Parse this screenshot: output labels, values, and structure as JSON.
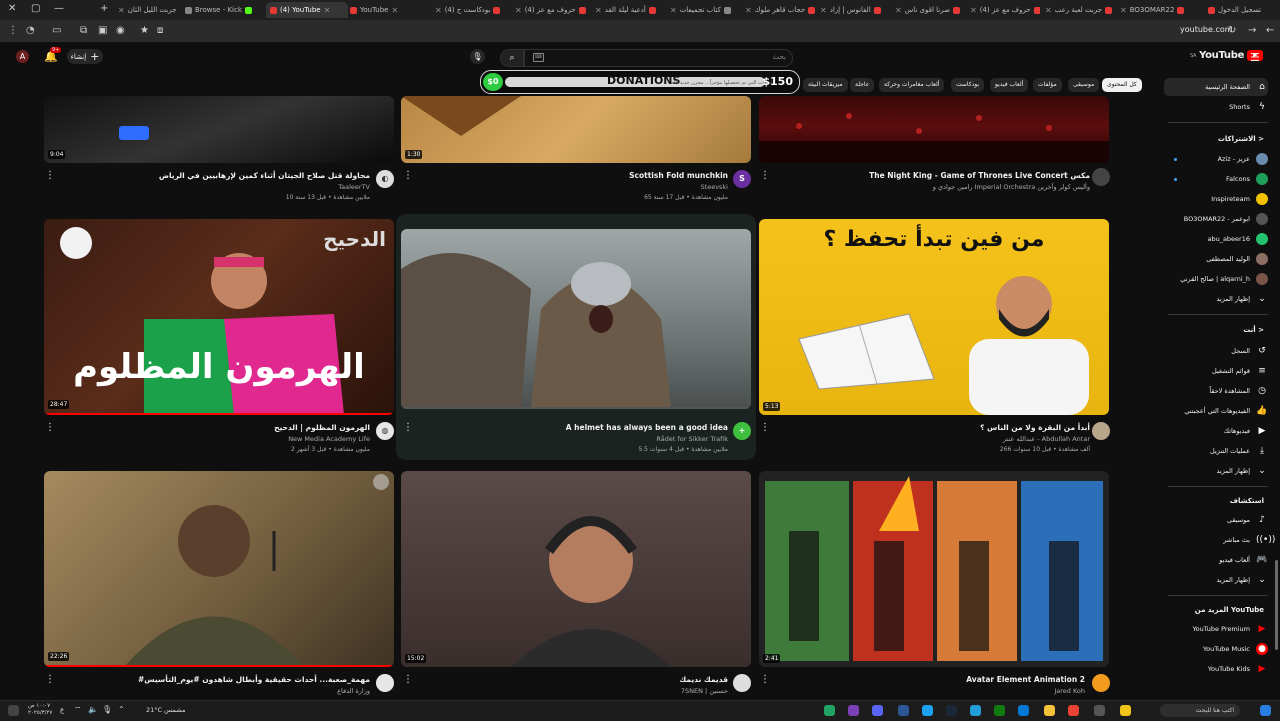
{
  "browser": {
    "tabs": [
      {
        "label": "تسجيل الدخول"
      },
      {
        "label": "BO3OMAR22"
      },
      {
        "label": "جربت لعبة رعب"
      },
      {
        "label": "(4) حروف مع عز"
      },
      {
        "label": "صرنا اقوى ناس"
      },
      {
        "label": "الفانوس | إراد"
      },
      {
        "label": "حجاب قاهر ملوك"
      },
      {
        "label": "كتاب تجميعات"
      },
      {
        "label": "أدعية ليلة القد"
      },
      {
        "label": "(4) حروف مع عز"
      },
      {
        "label": "(4) بودكاست ح"
      },
      {
        "label": "YouTube"
      },
      {
        "label": "(4) YouTube"
      },
      {
        "label": "Browse - Kick"
      },
      {
        "label": "جربت الليل الثان"
      }
    ],
    "address": "youtube.com"
  },
  "header": {
    "avatar_letter": "A",
    "notif_count": "9+",
    "create_label": "إنشاء",
    "search_placeholder": "بحث",
    "logo_text": "YouTube",
    "logo_region": "SA"
  },
  "donation": {
    "current": "$0",
    "title": "DONATIONS",
    "goal": "$150",
    "subtitle": "الفترات التي تم تحصيلها مؤخراً... مخزن حديد الله"
  },
  "chips": [
    {
      "label": "كل المحتوى",
      "active": true
    },
    {
      "label": "موسيقى"
    },
    {
      "label": "مؤلفات"
    },
    {
      "label": "ألعاب فيديو"
    },
    {
      "label": "بودكاست"
    },
    {
      "label": "ألعاب مغامرات وحركة"
    },
    {
      "label": "عاجلة"
    },
    {
      "label": "ميزيقات البيئة"
    }
  ],
  "sidebar": {
    "home": "الصفحة الرئيسية",
    "shorts": "Shorts",
    "subs_header": "الاشتراكات >",
    "subs": [
      {
        "label": "Aziz - عزيز",
        "color": "#6a8caf"
      },
      {
        "label": "Falcons",
        "color": "#1e9e5a"
      },
      {
        "label": "Inspireteam",
        "color": "#f2c200"
      },
      {
        "label": "BO3OMAR22 - ابوعمر",
        "color": "#444"
      },
      {
        "label": "abu_abeer16",
        "color": "#25c26e"
      },
      {
        "label": "الوليد المصطفى",
        "color": "#8d6e63"
      },
      {
        "label": "صالح القرني | alqarni_h",
        "color": "#795548"
      }
    ],
    "subs_more": "إظهار المزيد",
    "you_header": "أنت >",
    "you": [
      {
        "label": "السجل",
        "icon": "history-icon"
      },
      {
        "label": "قوائم التشغيل",
        "icon": "playlist-icon"
      },
      {
        "label": "المشاهدة لاحقاً",
        "icon": "clock-icon"
      },
      {
        "label": "الفيديوهات التي أعجبتني",
        "icon": "like-icon"
      },
      {
        "label": "فيديوهاتك",
        "icon": "video-icon"
      },
      {
        "label": "عمليات التنزيل",
        "icon": "download-icon"
      },
      {
        "label": "إظهار المزيد",
        "icon": "chevron-down-icon"
      }
    ],
    "explore_header": "استكشاف",
    "explore": [
      {
        "label": "موسيقى",
        "icon": "music-icon"
      },
      {
        "label": "بث مباشر",
        "icon": "live-icon"
      },
      {
        "label": "ألعاب فيديو",
        "icon": "gaming-icon"
      },
      {
        "label": "إظهار المزيد",
        "icon": "chevron-down-icon"
      }
    ],
    "more_header": "المزيد من YouTube",
    "more": [
      {
        "label": "YouTube Premium"
      },
      {
        "label": "YouTube Music"
      },
      {
        "label": "YouTube Kids"
      }
    ]
  },
  "videos": {
    "row1": [
      {
        "title": "The Night King - Game of Thrones Live Concert مكس",
        "channel": "رامين جوادي و Imperial Orchestra وأليس كولر وآخرين",
        "meta": ""
      },
      {
        "title": "Scottish Fold munchkin",
        "channel": "Steevski",
        "meta": "65 مليون مشاهدة • قبل 17 سنة",
        "duration": "1:30"
      },
      {
        "title": "محاولة قتل صلاح الجيتان أثناء كمين لإرهابيين في الرياض",
        "channel": "TaaleerTV",
        "meta": "10 ملايين مشاهدة • قبل 13 سنة",
        "duration": "9:04"
      }
    ],
    "row2": [
      {
        "title": "أبدأ من البقرة ولا من الناس ؟",
        "channel": "عبدالله عنتر - Abdullah Antar",
        "meta": "266 ألف مشاهدة • قبل 10 سنوات",
        "duration": "5:13",
        "thumb_text": "من فين تبدأ تحفظ ؟"
      },
      {
        "title": "A helmet has always been a good idea",
        "channel": "Rådet for Sikker Trafik",
        "meta": "5.5 ملايين مشاهدة • قبل 4 سنوات",
        "duration": ""
      },
      {
        "title": "الهرمون المظلوم | الدحيح",
        "channel": "New Media Academy Life",
        "meta": "2 مليون مشاهدة • قبل 3 أشهر",
        "duration": "28:47",
        "thumb_text": "الهرمون المظلوم",
        "thumb_brand": "الدحيح"
      }
    ],
    "row3": [
      {
        "title": "Avatar Element Animation 2",
        "channel": "Jared Koh",
        "meta": "",
        "duration": "2:41"
      },
      {
        "title": "قديمك نديمك",
        "channel": "7SNEN | حسنين",
        "meta": "",
        "duration": "15:02"
      },
      {
        "title": "#مهمة_صعبة... أحداث حقيقية وأبطال شاهدون #يوم_التأسيس",
        "channel": "وزارة الدفاع",
        "meta": "",
        "duration": "22:26"
      }
    ]
  },
  "taskbar": {
    "search_label": "اكتب هنا للبحث",
    "weather": "21°C مشمس",
    "time": "١٠:٠٧ ص",
    "date": "٢٠٢٥/٣/٢٧"
  }
}
